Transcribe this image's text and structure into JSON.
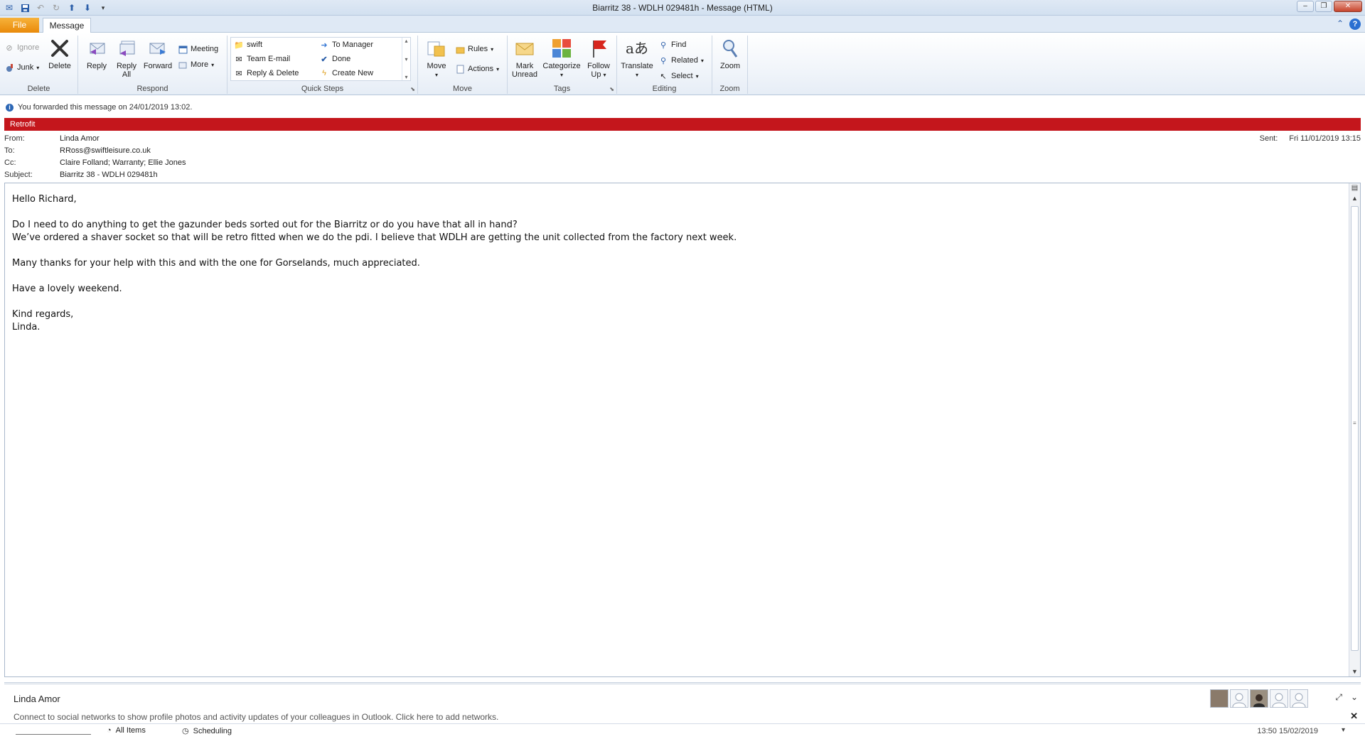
{
  "window": {
    "title": "Biarritz 38 - WDLH 029481h  -  Message (HTML)"
  },
  "tabs": {
    "file": "File",
    "message": "Message"
  },
  "ribbon": {
    "delete_group": {
      "label": "Delete",
      "ignore": "Ignore",
      "junk": "Junk",
      "delete": "Delete"
    },
    "respond_group": {
      "label": "Respond",
      "reply": "Reply",
      "reply_all_1": "Reply",
      "reply_all_2": "All",
      "forward": "Forward",
      "meeting": "Meeting",
      "more": "More"
    },
    "quick_steps": {
      "label": "Quick Steps",
      "items": [
        "swift",
        "Team E-mail",
        "Reply & Delete",
        "To Manager",
        "Done",
        "Create New"
      ]
    },
    "move_group": {
      "label": "Move",
      "move": "Move",
      "rules": "Rules",
      "actions": "Actions"
    },
    "tags_group": {
      "label": "Tags",
      "mark_unread_1": "Mark",
      "mark_unread_2": "Unread",
      "categorize": "Categorize",
      "follow_up_1": "Follow",
      "follow_up_2": "Up"
    },
    "editing_group": {
      "label": "Editing",
      "translate": "Translate",
      "find": "Find",
      "related": "Related",
      "select": "Select"
    },
    "zoom_group": {
      "label": "Zoom",
      "zoom": "Zoom"
    }
  },
  "infobar": {
    "text": "You forwarded this message on 24/01/2019 13:02."
  },
  "category": {
    "name": "Retrofit",
    "color": "#c4161c"
  },
  "headers": {
    "from_label": "From:",
    "from": "Linda Amor",
    "to_label": "To:",
    "to": "RRoss@swiftleisure.co.uk",
    "cc_label": "Cc:",
    "cc": "Claire Folland; Warranty; Ellie Jones",
    "subject_label": "Subject:",
    "subject": "Biarritz 38 - WDLH 029481h",
    "sent_label": "Sent:",
    "sent": "Fri 11/01/2019 13:15"
  },
  "body": {
    "greeting": "Hello Richard,",
    "line1": "Do I need to do anything to get the gazunder beds sorted out for the Biarritz or do you have that all in hand?",
    "line2": "We’ve ordered a shaver socket so that will be retro fitted when we do the pdi.  I believe that WDLH  are getting the unit collected from the factory next week.",
    "line3": "Many thanks for your help with this and with the one for Gorselands, much appreciated.",
    "line4": "Have a lovely weekend.",
    "signoff": "Kind regards,",
    "signature": "Linda."
  },
  "people_pane": {
    "name": "Linda Amor",
    "connect_text": "Connect to social networks to show profile photos and activity updates of your colleagues in Outlook. Click here to add networks."
  },
  "statusbar": {
    "all_items": "All Items",
    "scheduling": "Scheduling",
    "time": "13:50  15/02/2019"
  }
}
